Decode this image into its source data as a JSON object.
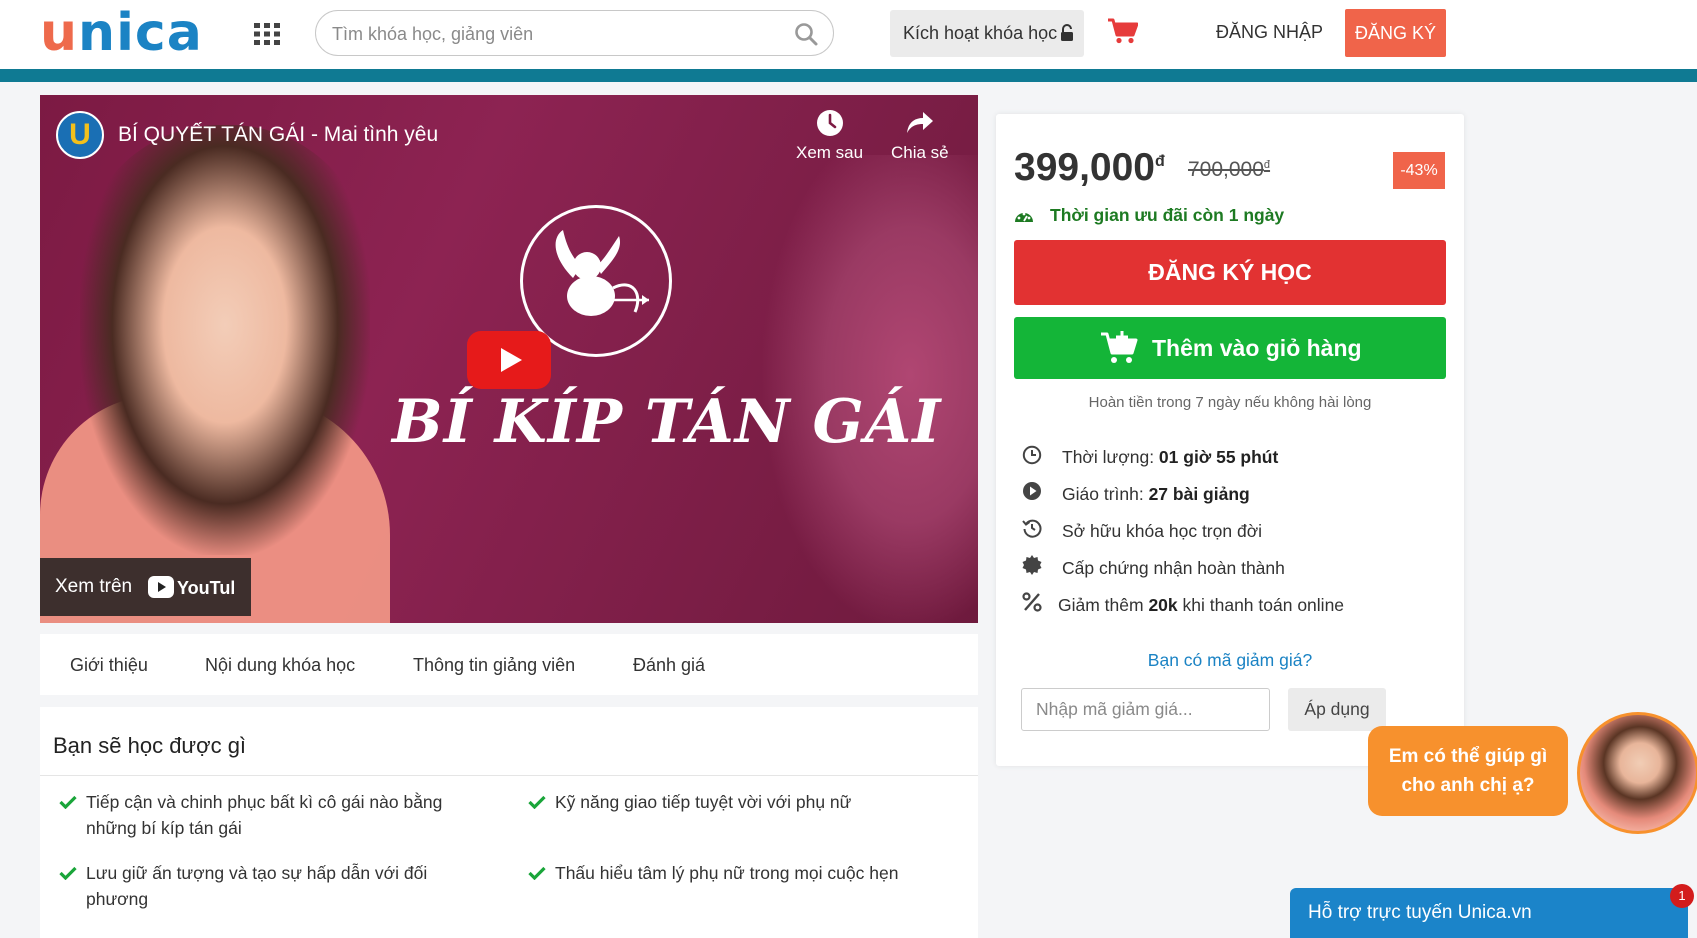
{
  "header": {
    "logo_part1": "u",
    "logo_part2": "n",
    "logo_part3": "i",
    "logo_part4": "ca",
    "search_placeholder": "Tìm khóa học, giảng viên",
    "activate_label": "Kích hoạt khóa học",
    "login_label": "ĐĂNG NHẬP",
    "register_label": "ĐĂNG KÝ"
  },
  "video": {
    "channel_letter": "U",
    "title": "BÍ QUYẾT TÁN GÁI - Mai tình yêu",
    "watch_later": "Xem sau",
    "share": "Chia sẻ",
    "thumbnail_text": "BÍ KÍP TÁN GÁI",
    "watch_on": "Xem trên",
    "youtube_logo": "YouTube"
  },
  "tabs": [
    "Giới thiệu",
    "Nội dung khóa học",
    "Thông tin giảng viên",
    "Đánh giá"
  ],
  "learn": {
    "title": "Bạn sẽ học được gì",
    "items": [
      "Tiếp cận và chinh phục bất kì cô gái nào bằng những bí kíp tán gái",
      "Kỹ năng giao tiếp tuyệt vời với phụ nữ",
      "Lưu giữ ấn tượng và tạo sự hấp dẫn với đối phương",
      "Thấu hiểu tâm lý phụ nữ trong mọi cuộc hẹn"
    ]
  },
  "pricing": {
    "price": "399,000",
    "currency": "đ",
    "old_price": "700,000",
    "discount": "-43%",
    "deadline": "Thời gian ưu đãi còn 1 ngày",
    "enroll_label": "ĐĂNG KÝ HỌC",
    "cart_label": "Thêm vào giỏ hàng",
    "refund_note": "Hoàn tiền trong 7 ngày nếu không hài lòng",
    "features": {
      "duration_label": "Thời lượng: ",
      "duration_value": "01 giờ 55 phút",
      "lessons_label": "Giáo trình: ",
      "lessons_value": "27 bài giảng",
      "lifetime": "Sở hữu khóa học trọn đời",
      "certificate": "Cấp chứng nhận hoàn thành",
      "discount_prefix": "Giảm thêm ",
      "discount_value": "20k",
      "discount_suffix": " khi thanh toán online"
    },
    "coupon_question": "Bạn có mã giảm giá?",
    "coupon_placeholder": "Nhập mã giảm giá...",
    "coupon_apply": "Áp dụng"
  },
  "chat": {
    "bubble_line1": "Em có thể giúp gì",
    "bubble_line2": "cho anh chị ạ?",
    "support_label": "Hỗ trợ trực tuyến Unica.vn",
    "badge_count": "1"
  },
  "colors": {
    "accent": "#f0644a",
    "brand_blue": "#1b83c4",
    "teal": "#0f7a93",
    "enroll_red": "#e23232",
    "cart_green": "#14b538"
  }
}
